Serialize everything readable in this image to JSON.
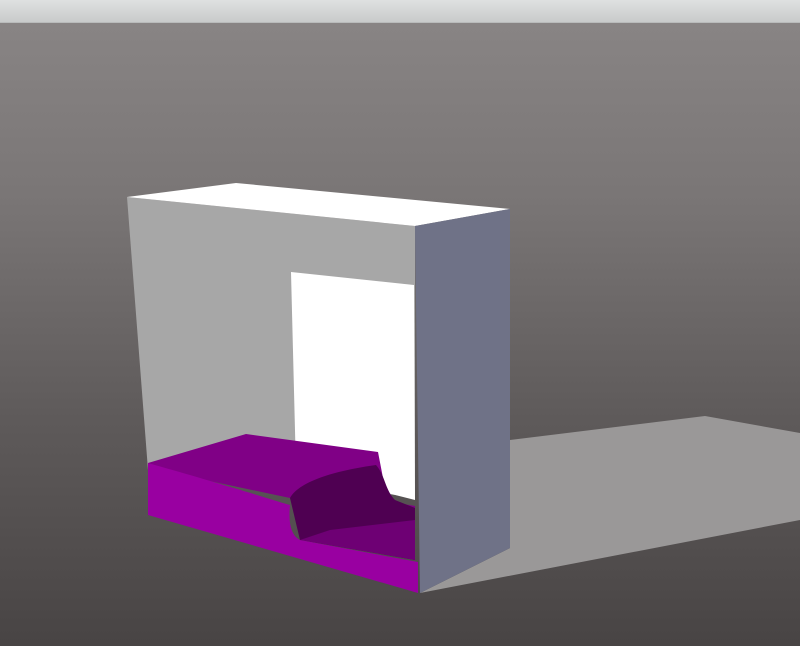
{
  "viewer": {
    "background_top": "#8a8686",
    "background_bottom": "#484444",
    "toolbar_color": "#d6d8d8"
  },
  "model": {
    "shape": "hollow box with open front",
    "colors": {
      "top_face": "#ffffff",
      "right_face": "#6f7287",
      "inner_back_wall": "#ffffff",
      "inner_left_wall": "#a7a7a7",
      "insert_front": "#9900a1",
      "insert_top": "#7c0082",
      "insert_shadow": "#4f0052",
      "floor_shadow": "#9a9898"
    }
  }
}
